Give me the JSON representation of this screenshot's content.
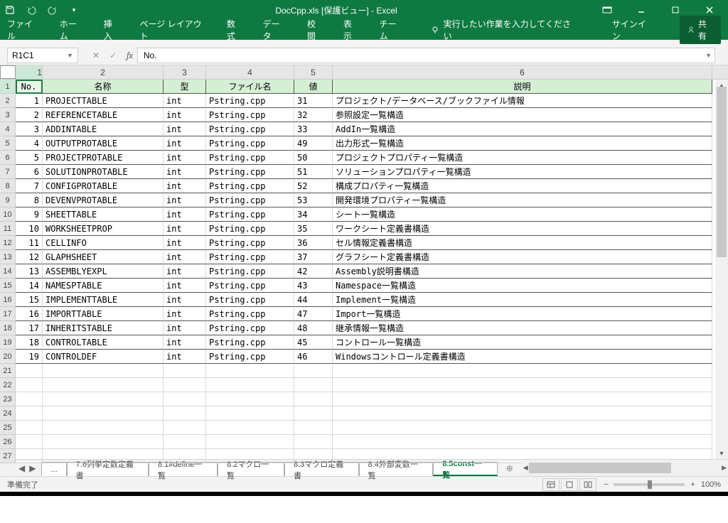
{
  "title": "DocCpp.xls  [保護ビュー] - Excel",
  "ribbon": {
    "file": "ファイル",
    "home": "ホーム",
    "insert": "挿入",
    "layout": "ページ レイアウト",
    "formulas": "数式",
    "data": "データ",
    "review": "校閲",
    "view": "表示",
    "team": "チーム",
    "tellme": "実行したい作業を入力してください",
    "signin": "サインイン",
    "share": "共有"
  },
  "namebox": "R1C1",
  "formula": "No.",
  "colnums": {
    "c1": "1",
    "c2": "2",
    "c3": "3",
    "c4": "4",
    "c5": "5",
    "c6": "6"
  },
  "headers": {
    "no": "No.",
    "name": "名称",
    "type": "型",
    "file": "ファイル名",
    "val": "値",
    "desc": "説明"
  },
  "rows": [
    {
      "r": "2",
      "no": "1",
      "name": "PROJECTTABLE",
      "type": "int",
      "file": "Pstring.cpp",
      "val": "31",
      "desc": "プロジェクト/データベース/ブックファイル情報"
    },
    {
      "r": "3",
      "no": "2",
      "name": "REFERENCETABLE",
      "type": "int",
      "file": "Pstring.cpp",
      "val": "32",
      "desc": "参照設定一覧構造"
    },
    {
      "r": "4",
      "no": "3",
      "name": "ADDINTABLE",
      "type": "int",
      "file": "Pstring.cpp",
      "val": "33",
      "desc": "AddIn一覧構造"
    },
    {
      "r": "5",
      "no": "4",
      "name": "OUTPUTPROTABLE",
      "type": "int",
      "file": "Pstring.cpp",
      "val": "49",
      "desc": "出力形式一覧構造"
    },
    {
      "r": "6",
      "no": "5",
      "name": "PROJECTPROTABLE",
      "type": "int",
      "file": "Pstring.cpp",
      "val": "50",
      "desc": "プロジェクトプロパティ一覧構造"
    },
    {
      "r": "7",
      "no": "6",
      "name": "SOLUTIONPROTABLE",
      "type": "int",
      "file": "Pstring.cpp",
      "val": "51",
      "desc": "ソリューションプロパティ一覧構造"
    },
    {
      "r": "8",
      "no": "7",
      "name": "CONFIGPROTABLE",
      "type": "int",
      "file": "Pstring.cpp",
      "val": "52",
      "desc": "構成プロパティ一覧構造"
    },
    {
      "r": "9",
      "no": "8",
      "name": "DEVENVPROTABLE",
      "type": "int",
      "file": "Pstring.cpp",
      "val": "53",
      "desc": "開発環境プロパティ一覧構造"
    },
    {
      "r": "10",
      "no": "9",
      "name": "SHEETTABLE",
      "type": "int",
      "file": "Pstring.cpp",
      "val": "34",
      "desc": "シート一覧構造"
    },
    {
      "r": "11",
      "no": "10",
      "name": "WORKSHEETPROP",
      "type": "int",
      "file": "Pstring.cpp",
      "val": "35",
      "desc": "ワークシート定義書構造"
    },
    {
      "r": "12",
      "no": "11",
      "name": "CELLINFO",
      "type": "int",
      "file": "Pstring.cpp",
      "val": "36",
      "desc": "セル情報定義書構造"
    },
    {
      "r": "13",
      "no": "12",
      "name": "GLAPHSHEET",
      "type": "int",
      "file": "Pstring.cpp",
      "val": "37",
      "desc": "グラフシート定義書構造"
    },
    {
      "r": "14",
      "no": "13",
      "name": "ASSEMBLYEXPL",
      "type": "int",
      "file": "Pstring.cpp",
      "val": "42",
      "desc": "Assembly説明書構造"
    },
    {
      "r": "15",
      "no": "14",
      "name": "NAMESPTABLE",
      "type": "int",
      "file": "Pstring.cpp",
      "val": "43",
      "desc": "Namespace一覧構造"
    },
    {
      "r": "16",
      "no": "15",
      "name": "IMPLEMENTTABLE",
      "type": "int",
      "file": "Pstring.cpp",
      "val": "44",
      "desc": "Implement一覧構造"
    },
    {
      "r": "17",
      "no": "16",
      "name": "IMPORTTABLE",
      "type": "int",
      "file": "Pstring.cpp",
      "val": "47",
      "desc": "Import一覧構造"
    },
    {
      "r": "18",
      "no": "17",
      "name": "INHERITSTABLE",
      "type": "int",
      "file": "Pstring.cpp",
      "val": "48",
      "desc": "継承情報一覧構造"
    },
    {
      "r": "19",
      "no": "18",
      "name": "CONTROLTABLE",
      "type": "int",
      "file": "Pstring.cpp",
      "val": "45",
      "desc": "コントロール一覧構造"
    },
    {
      "r": "20",
      "no": "19",
      "name": "CONTROLDEF",
      "type": "int",
      "file": "Pstring.cpp",
      "val": "46",
      "desc": "Windowsコントロール定義書構造"
    }
  ],
  "emptyRows": [
    "21",
    "22",
    "23",
    "24",
    "25",
    "26",
    "27"
  ],
  "tabs": {
    "more": "...",
    "t1": "7.6列挙定数定義書",
    "t2": "8.1#define一覧",
    "t3": "8.2マクロ一覧",
    "t4": "8.3マクロ定義書",
    "t5": "8.4外部変数一覧",
    "t6": "8.5const一覧"
  },
  "status": {
    "ready": "準備完了",
    "zoom": "100%",
    "plus": "+",
    "minus": "−"
  }
}
